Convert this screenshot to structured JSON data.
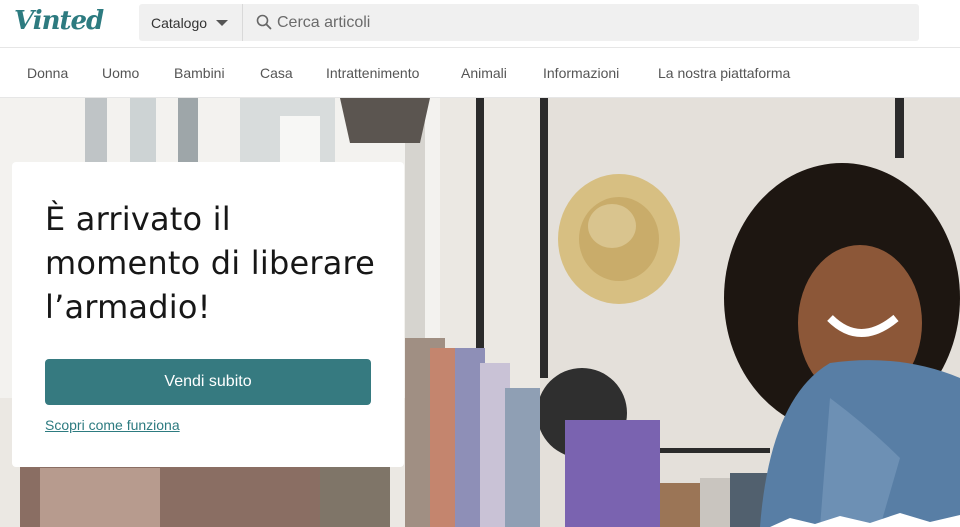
{
  "header": {
    "logo": "Vinted",
    "catalog_label": "Catalogo",
    "search_placeholder": "Cerca articoli"
  },
  "nav": {
    "items": [
      "Donna",
      "Uomo",
      "Bambini",
      "Casa",
      "Intrattenimento",
      "Animali",
      "Informazioni",
      "La nostra piattaforma"
    ]
  },
  "hero": {
    "title": "È arrivato il momento di liberare l’armadio!",
    "cta_label": "Vendi subito",
    "link_label": "Scopri come funziona"
  },
  "colors": {
    "brand": "#2d7b80",
    "cta": "#367a80"
  },
  "icons": [
    "search-icon",
    "chevron-down-icon"
  ]
}
